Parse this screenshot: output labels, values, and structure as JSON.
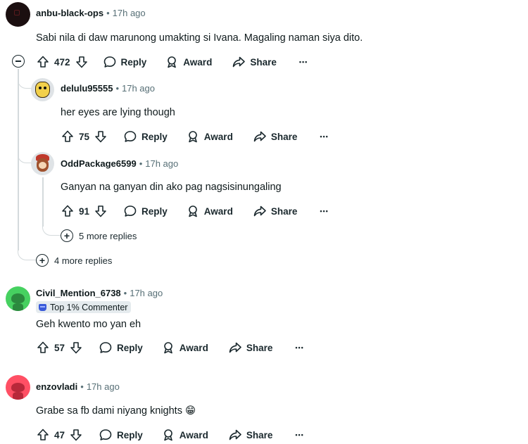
{
  "comments": [
    {
      "username": "anbu-black-ops",
      "time": "17h ago",
      "text": "Sabi nila di daw marunong umakting si Ivana. Magaling naman siya dito.",
      "votes": "472",
      "avatar_color": "#1b0f10"
    },
    {
      "username": "delulu95555",
      "time": "17h ago",
      "text": "her eyes are lying though",
      "votes": "75",
      "avatar_color": "#f2d04b"
    },
    {
      "username": "OddPackage6599",
      "time": "17h ago",
      "text": "Ganyan na ganyan din ako pag nagsisinungaling",
      "votes": "91",
      "avatar_color": "#c0392b"
    },
    {
      "username": "Civil_Mention_6738",
      "time": "17h ago",
      "badge": "Top 1% Commenter",
      "text": "Geh kwento mo yan eh",
      "votes": "57",
      "avatar_color": "#46d160"
    },
    {
      "username": "enzovladi",
      "time": "17h ago",
      "text": "Grabe sa fb dami niyang knights 😁",
      "votes": "47",
      "avatar_color": "#ff4f64"
    }
  ],
  "actions": {
    "reply": "Reply",
    "award": "Award",
    "share": "Share",
    "more": "•••"
  },
  "more_replies": {
    "nested": "5 more replies",
    "top": "4 more replies"
  },
  "separator": "•",
  "icons": [
    "upvote-icon",
    "downvote-icon",
    "comment-icon",
    "award-icon",
    "share-icon",
    "collapse-icon",
    "expand-icon"
  ]
}
